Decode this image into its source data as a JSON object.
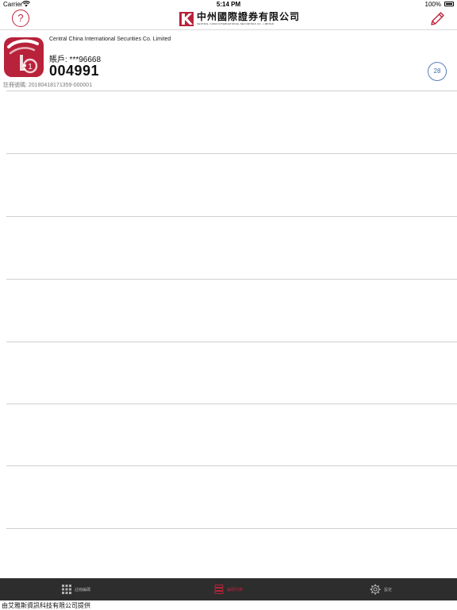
{
  "status_bar": {
    "carrier": "Carrier",
    "time": "5:14 PM",
    "battery": "100%"
  },
  "nav": {
    "logo_cn": "中州國際證券有限公司",
    "logo_en": "CENTRAL CHINA INTERNATIONAL SECURITIES CO., LIMITED",
    "help_symbol": "?"
  },
  "account": {
    "company_name": "Central China International Securities Co. Limited",
    "account_label": "賬戶: ***96668",
    "code": "004991",
    "timer": "28",
    "registration": "註冊號碼: 20180418171359-000001"
  },
  "list_rows": 8,
  "tabs": [
    {
      "label": "註冊編碼",
      "icon": "grid-icon"
    },
    {
      "label": "編碼列表",
      "icon": "stack-icon"
    },
    {
      "label": "設定",
      "icon": "gear-icon"
    }
  ],
  "footer": {
    "credit": "由艾雅斯資訊科技有限公司提供"
  },
  "colors": {
    "brand": "#b8223a",
    "accent_blue": "#3f6aa8",
    "tab_bg": "#2d2d2d"
  }
}
